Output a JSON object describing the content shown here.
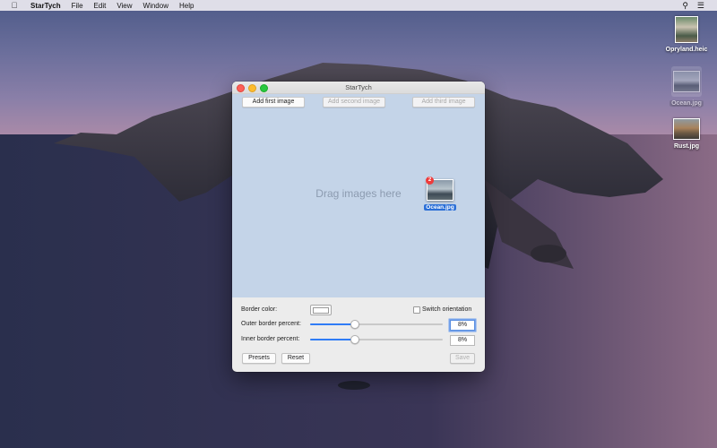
{
  "menubar": {
    "apple_icon": "apple-logo",
    "app_name": "StarTych",
    "items": [
      "File",
      "Edit",
      "View",
      "Window",
      "Help"
    ],
    "right_icons": [
      "search-icon",
      "list-icon"
    ]
  },
  "desktop": {
    "icons": [
      {
        "label": "Opryland.heic"
      },
      {
        "label": "Ocean.jpg"
      },
      {
        "label": "Rust.jpg"
      }
    ]
  },
  "window": {
    "title": "StarTych",
    "add_first": "Add first image",
    "add_second": "Add second image",
    "add_third": "Add third image",
    "drag_hint": "Drag images here",
    "dragged_file": {
      "label": "Ocean.jpg",
      "badge": "2"
    },
    "border_color_label": "Border color:",
    "border_color": "#ffffff",
    "switch_orientation": "Switch orientation",
    "switch_orientation_checked": false,
    "outer_label": "Outer border percent:",
    "outer_value": "8%",
    "outer_slider_fraction": 0.33,
    "inner_label": "Inner border percent:",
    "inner_value": "8%",
    "inner_slider_fraction": 0.33,
    "presets": "Presets",
    "reset": "Reset",
    "save": "Save"
  }
}
